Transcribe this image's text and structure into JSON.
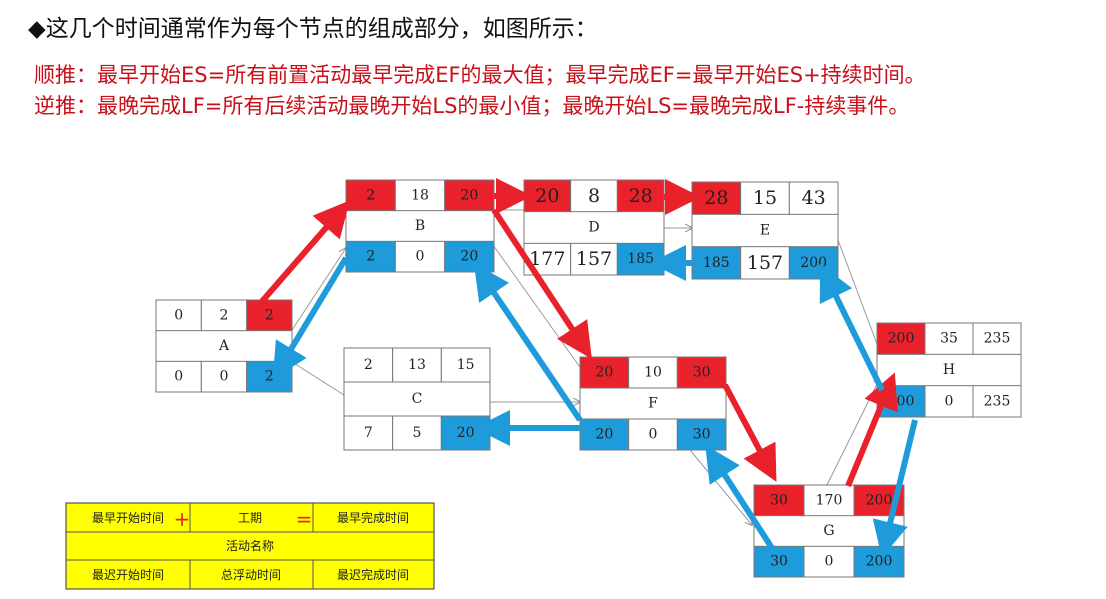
{
  "header": {
    "line1": "◆这几个时间通常作为每个节点的组成部分，如图所示：",
    "line2": "顺推：最早开始ES=所有前置活动最早完成EF的最大值；最早完成EF=最早开始ES+持续时间。",
    "line3": "逆推：最晚完成LF=所有后续活动最晚开始LS的最小值；最晚开始LS=最晚完成LF-持续事件。"
  },
  "colors": {
    "forward": "#e8212b",
    "backward": "#1e9bdb",
    "legend_bg": "#ffff00",
    "text_red": "#c8101a"
  },
  "nodes": {
    "A": {
      "name": "A",
      "es": "0",
      "dur": "2",
      "ef": "2",
      "ls": "0",
      "tf": "0",
      "lf": "2"
    },
    "B": {
      "name": "B",
      "es": "2",
      "dur": "18",
      "ef": "20",
      "ls": "2",
      "tf": "0",
      "lf": "20"
    },
    "C": {
      "name": "C",
      "es": "2",
      "dur": "13",
      "ef": "15",
      "ls": "7",
      "tf": "5",
      "lf": "20"
    },
    "D": {
      "name": "D",
      "es": "20",
      "dur": "8",
      "ef": "28",
      "ls": "177",
      "tf": "157",
      "lf": "185"
    },
    "E": {
      "name": "E",
      "es": "28",
      "dur": "15",
      "ef": "43",
      "ls": "185",
      "tf": "157",
      "lf": "200"
    },
    "F": {
      "name": "F",
      "es": "20",
      "dur": "10",
      "ef": "30",
      "ls": "20",
      "tf": "0",
      "lf": "30"
    },
    "G": {
      "name": "G",
      "es": "30",
      "dur": "170",
      "ef": "200",
      "ls": "30",
      "tf": "0",
      "lf": "200"
    },
    "H": {
      "name": "H",
      "es": "200",
      "dur": "35",
      "ef": "235",
      "ls": "200",
      "tf": "0",
      "lf": "235"
    }
  },
  "legend": {
    "es": "最早开始时间",
    "plus": "+",
    "dur": "工期",
    "eq": "=",
    "ef": "最早完成时间",
    "name": "活动名称",
    "ls": "最迟开始时间",
    "tf": "总浮动时间",
    "lf": "最迟完成时间"
  }
}
